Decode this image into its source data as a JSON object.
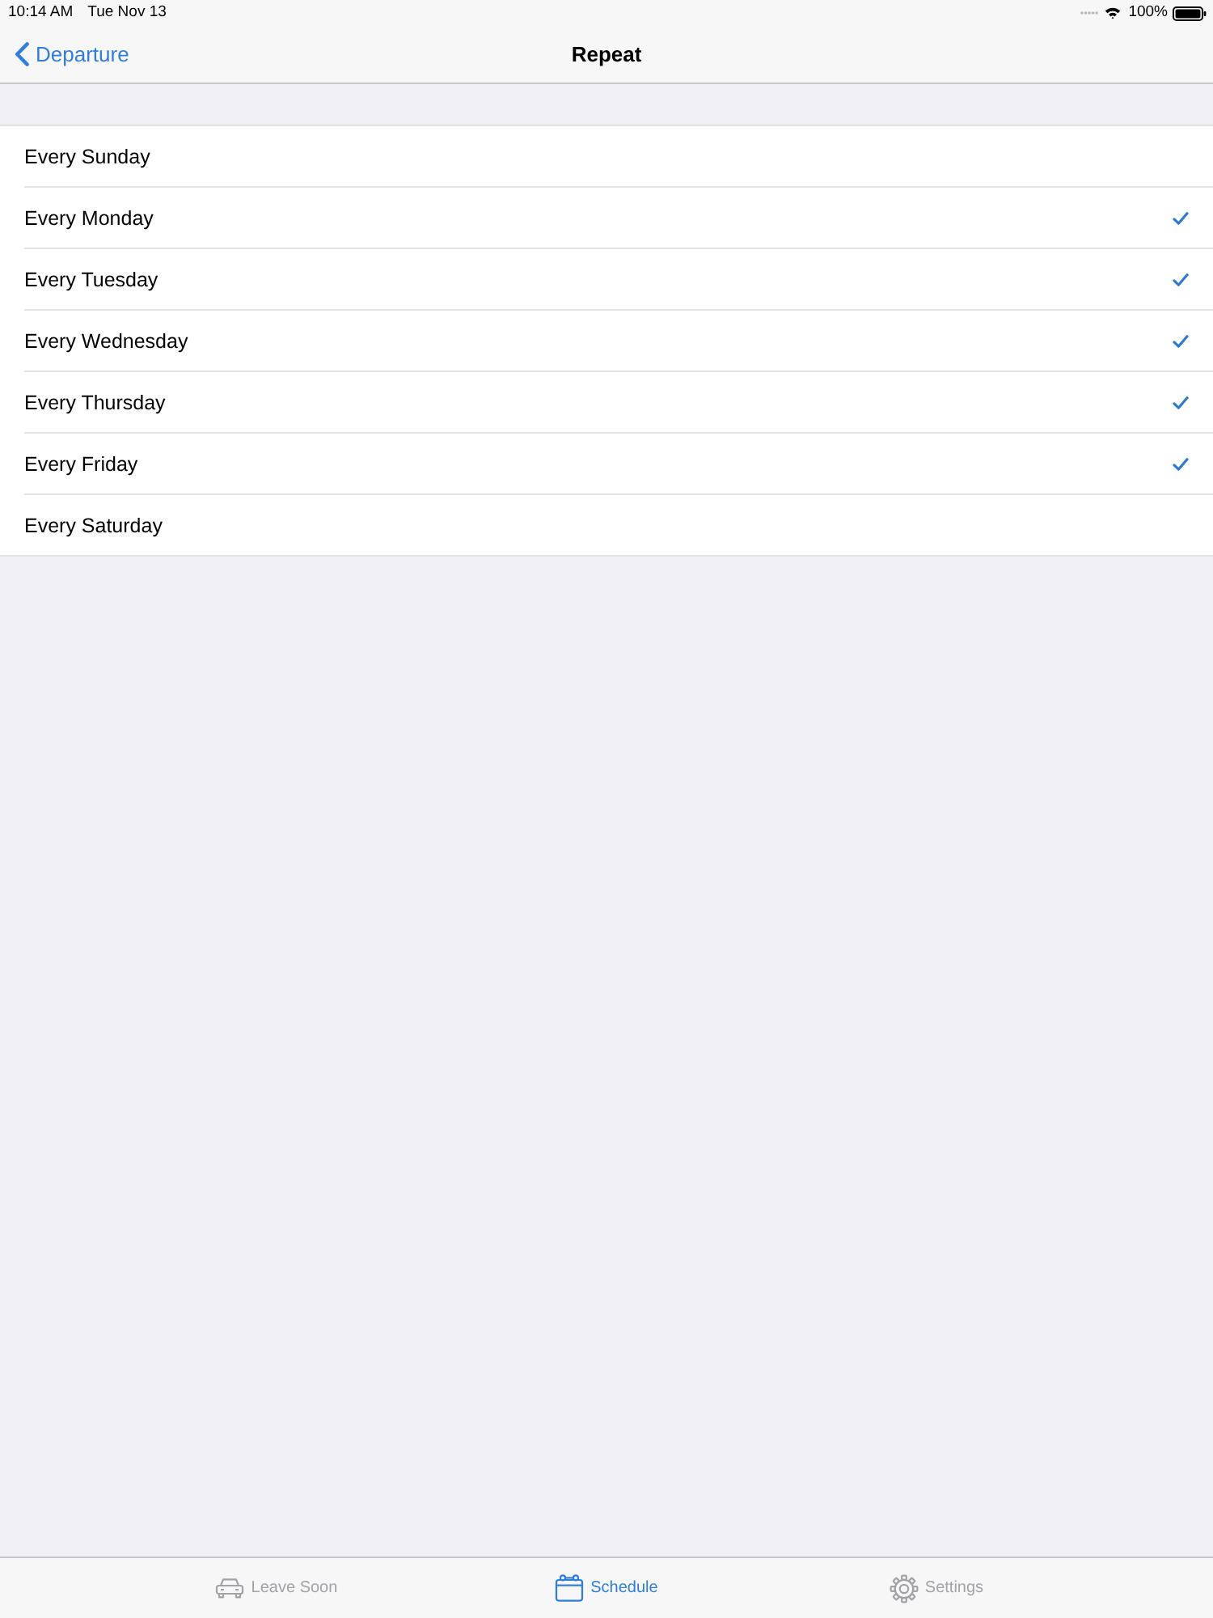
{
  "status_bar": {
    "time": "10:14 AM",
    "date": "Tue Nov 13",
    "battery": "100%"
  },
  "nav_bar": {
    "back": "Departure",
    "title": "Repeat"
  },
  "rows": [
    {
      "label": "Every Sunday",
      "checked": false
    },
    {
      "label": "Every Monday",
      "checked": true
    },
    {
      "label": "Every Tuesday",
      "checked": true
    },
    {
      "label": "Every Wednesday",
      "checked": true
    },
    {
      "label": "Every Thursday",
      "checked": true
    },
    {
      "label": "Every Friday",
      "checked": true
    },
    {
      "label": "Every Saturday",
      "checked": false
    }
  ],
  "tab_bar": [
    {
      "label": "Leave Soon",
      "selected": false
    },
    {
      "label": "Schedule",
      "selected": true
    },
    {
      "label": "Settings",
      "selected": false
    }
  ]
}
